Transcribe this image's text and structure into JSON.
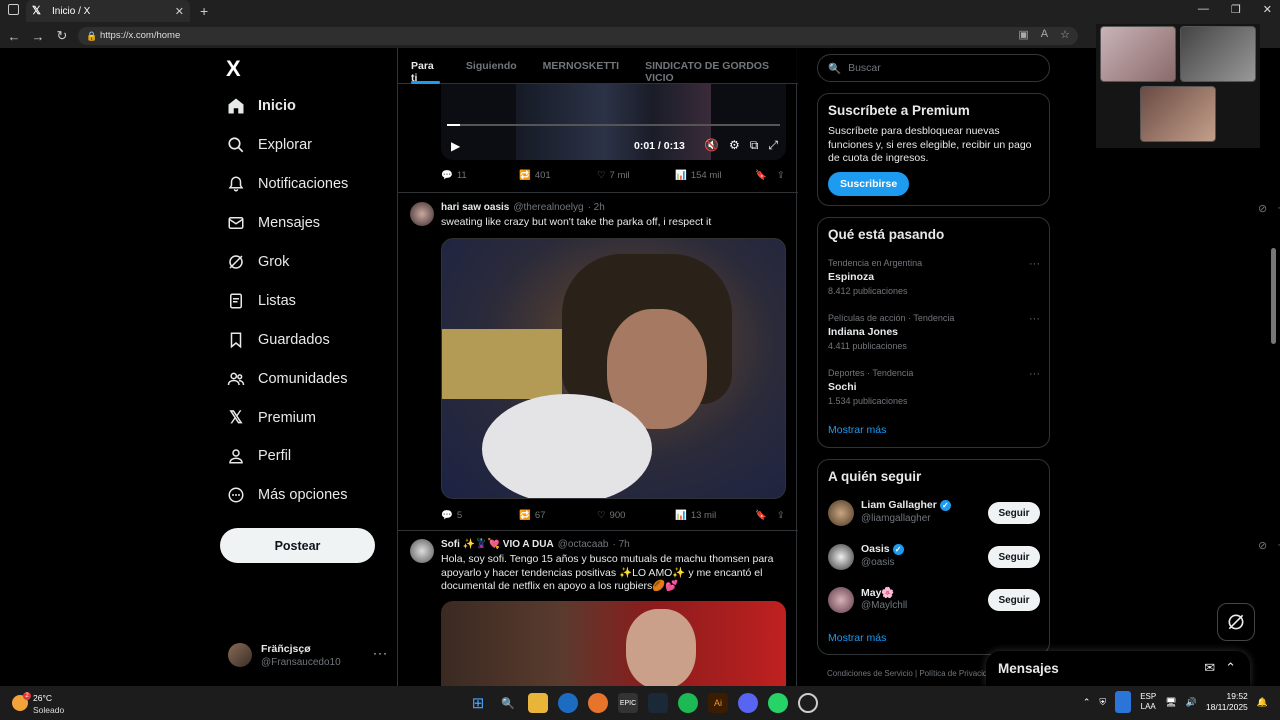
{
  "browser": {
    "tab_title": "Inicio / X",
    "new_tab": "+",
    "url": "https://x.com/home"
  },
  "nav": {
    "logo": "X",
    "items": [
      {
        "label": "Inicio",
        "icon": "home-icon"
      },
      {
        "label": "Explorar",
        "icon": "search-icon"
      },
      {
        "label": "Notificaciones",
        "icon": "bell-icon"
      },
      {
        "label": "Mensajes",
        "icon": "envelope-icon"
      },
      {
        "label": "Grok",
        "icon": "grok-icon"
      },
      {
        "label": "Listas",
        "icon": "list-icon"
      },
      {
        "label": "Guardados",
        "icon": "bookmark-icon"
      },
      {
        "label": "Comunidades",
        "icon": "people-icon"
      },
      {
        "label": "Premium",
        "icon": "x-logo-icon"
      },
      {
        "label": "Perfil",
        "icon": "person-icon"
      },
      {
        "label": "Más opciones",
        "icon": "more-circle-icon"
      }
    ],
    "post_button": "Postear",
    "profile": {
      "name": "Fräñcjsçø",
      "handle": "@Fransaucedo10"
    }
  },
  "feed": {
    "tabs": [
      "Para ti",
      "Siguiendo",
      "MERNOSKETTI",
      "SINDICATO DE GORDOS VICIO"
    ],
    "video1": {
      "time": "0:01 / 0:13",
      "progress": 0.04
    },
    "tweet1_stats": {
      "replies": "11",
      "reposts": "401",
      "likes": "7 mil",
      "views": "154 mil"
    },
    "tweet2": {
      "name": "hari saw oasis",
      "handle": "@therealnoelyg",
      "time": "· 2h",
      "text": "sweating like crazy but won't take the parka off, i respect it",
      "stats": {
        "replies": "5",
        "reposts": "67",
        "likes": "900",
        "views": "13 mil"
      }
    },
    "tweet3": {
      "name": "Sofi ✨🦹🏻‍♀️💘 VIO A DUA",
      "handle": "@octacaab",
      "time": "· 7h",
      "text": "Hola, soy sofi. Tengo 15 años y busco mutuals de machu thomsen para apoyarlo y hacer tendencias positivas ✨LO AMO✨ y me encantó el documental de netflix en apoyo a los rugbiers🏉💕"
    }
  },
  "sidebar": {
    "search_placeholder": "Buscar",
    "premium": {
      "title": "Suscríbete a Premium",
      "text": "Suscríbete para desbloquear nuevas funciones y, si eres elegible, recibir un pago de cuota de ingresos.",
      "button": "Suscribirse"
    },
    "trends": {
      "title": "Qué está pasando",
      "items": [
        {
          "context": "Tendencia en Argentina",
          "topic": "Espinoza",
          "count": "8.412 publicaciones"
        },
        {
          "context": "Películas de acción · Tendencia",
          "topic": "Indiana Jones",
          "count": "4.411 publicaciones"
        },
        {
          "context": "Deportes · Tendencia",
          "topic": "Sochi",
          "count": "1.534 publicaciones"
        }
      ],
      "more": "Mostrar más"
    },
    "who_to_follow": {
      "title": "A quién seguir",
      "items": [
        {
          "name": "Liam Gallagher",
          "handle": "@liamgallagher",
          "verified": true
        },
        {
          "name": "Oasis",
          "handle": "@oasis",
          "verified": true
        },
        {
          "name": "May🌸",
          "handle": "@Maylchll",
          "verified": false
        }
      ],
      "button": "Seguir",
      "more": "Mostrar más"
    },
    "footer": "Condiciones de Servicio  |  Política de Privacidad"
  },
  "messages_drawer": {
    "title": "Mensajes"
  },
  "taskbar": {
    "weather_temp": "26°C",
    "weather_cond": "Soleado",
    "weather_badge": "2",
    "lang_top": "ESP",
    "lang_bottom": "LAA",
    "time": "19:52",
    "date": "18/11/2025"
  }
}
